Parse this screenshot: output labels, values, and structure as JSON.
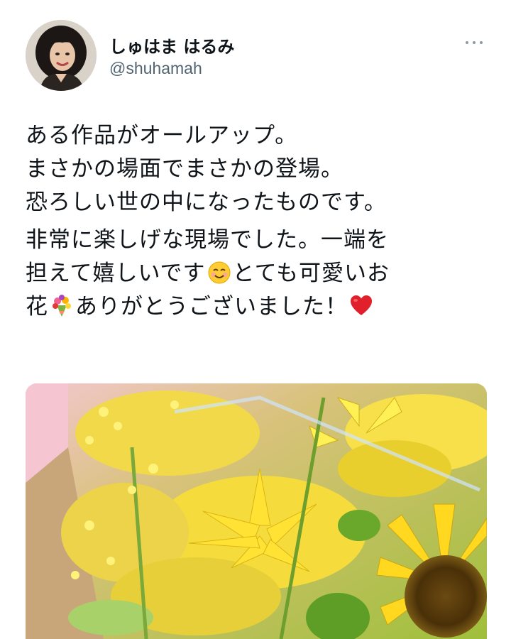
{
  "user": {
    "display_name": "しゅはま はるみ",
    "handle": "@shuhamah"
  },
  "tweet": {
    "paragraph1": [
      "ある作品がオールアップ。",
      "まさかの場面でまさかの登場。",
      "恐ろしい世の中になったものです。"
    ],
    "paragraph2": {
      "line1": "非常に楽しげな現場でした。一端を",
      "line2_a": "担えて嬉しいです",
      "line2_b": "とても可愛いお",
      "line3_a": "花",
      "line3_b": "ありがとうございました！"
    }
  },
  "icons": {
    "more": "more-icon",
    "smile": "smiling-face-emoji",
    "bouquet": "bouquet-emoji",
    "heart": "red-heart-emoji"
  },
  "colors": {
    "text": "#0f1419",
    "secondary": "#536471",
    "sunflower": "#f4d31b",
    "leaf": "#8fbf3a"
  }
}
